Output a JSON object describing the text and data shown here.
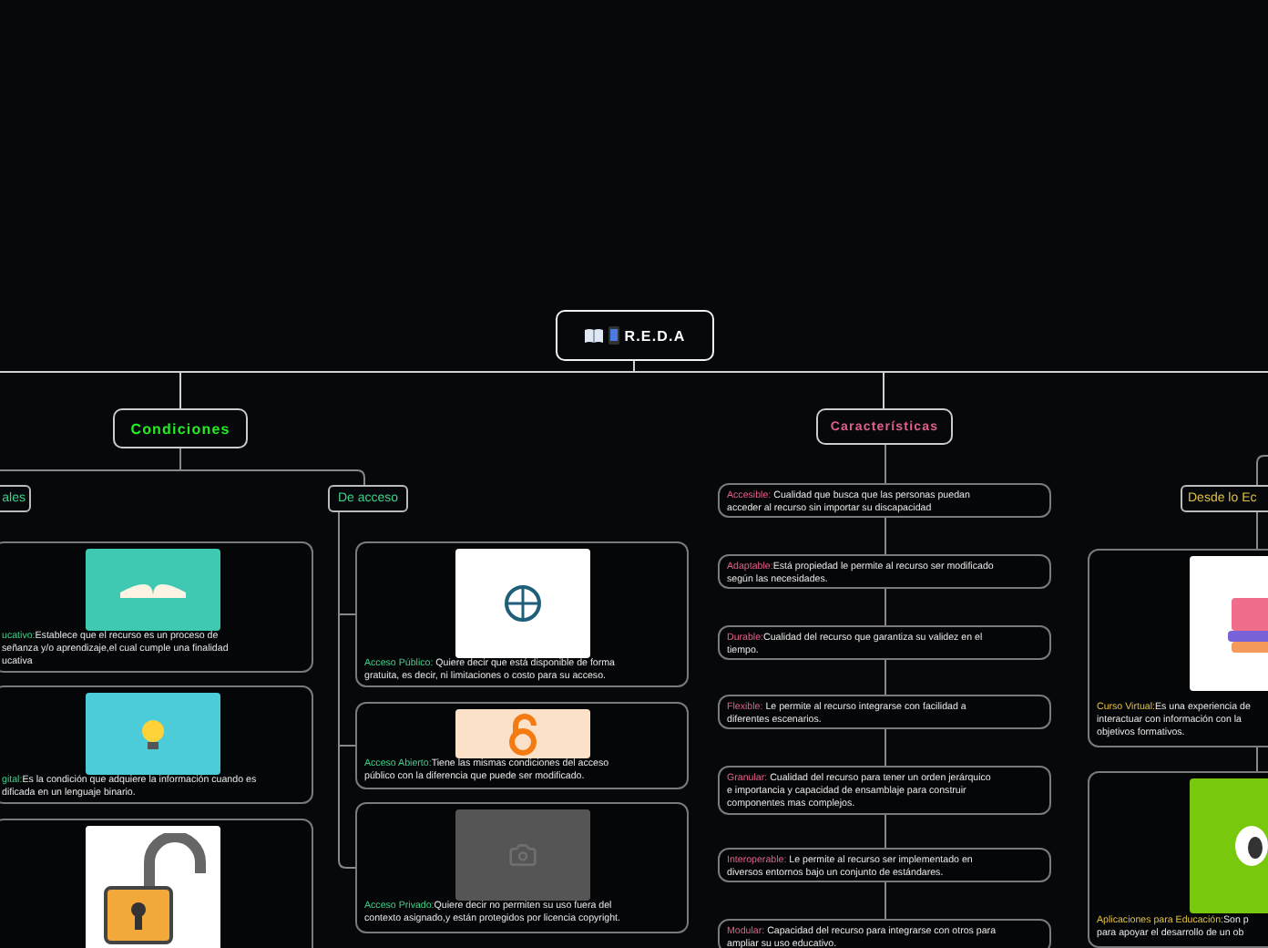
{
  "root": {
    "title": "R.E.D.A"
  },
  "condiciones": {
    "title": "Condiciones",
    "color": "#22ee22",
    "groups": [
      {
        "title": "ales",
        "color": "#3fd08a",
        "cards": [
          {
            "kind": "picture-note",
            "label": "ucativo:",
            "lines": [
              "Establece que el recurso es un proceso de",
              "señanza y/o aprendizaje,el cual cumple una finalidad",
              "ucativa"
            ]
          },
          {
            "kind": "picture-note",
            "label": "gital:",
            "lines": [
              "Es la condición que adquiere la información cuando es",
              "dificada en un lenguaje binario."
            ]
          },
          {
            "kind": "picture"
          }
        ]
      },
      {
        "title": "De acceso",
        "color": "#3fd08a",
        "cards": [
          {
            "kind": "picture-note",
            "label": "Acceso Público:",
            "lines": [
              " Quiere decir que está disponible de forma",
              "gratuita, es decir, ni limitaciones o costo para su acceso."
            ]
          },
          {
            "kind": "picture-note",
            "label": "Acceso Abierto:",
            "lines": [
              "Tiene las mismas condiciones del acceso",
              "público con la diferencia que puede ser modificado."
            ]
          },
          {
            "kind": "picture-note",
            "label": "Acceso Privado:",
            "lines": [
              "Quiere decir no permiten su uso fuera del",
              "contexto asignado,y están protegidos por licencia copyright."
            ]
          }
        ]
      }
    ]
  },
  "caracteristicas": {
    "title": "Características",
    "color": "#e0608a",
    "cards": [
      {
        "kind": "note",
        "label": "Accesible:",
        "lines": [
          " Cualidad que busca que las personas puedan",
          "acceder al recurso sin importar su discapacidad"
        ]
      },
      {
        "kind": "note",
        "label": "Adaptable:",
        "lines": [
          "Está propiedad le permite al recurso ser modificado",
          "según las necesidades."
        ]
      },
      {
        "kind": "note",
        "label": "Durable:",
        "lines": [
          "Cualidad del recurso que garantiza su validez en el",
          "tiempo."
        ]
      },
      {
        "kind": "note",
        "label": "Flexible:",
        "lines": [
          " Le permite al recurso integrarse con facilidad a",
          "diferentes escenarios."
        ]
      },
      {
        "kind": "note",
        "label": "Granular:",
        "lines": [
          " Cualidad del recurso para tener un orden jerárquico",
          "e importancia y capacidad de ensamblaje para construir",
          "componentes mas complejos."
        ]
      },
      {
        "kind": "note",
        "label": "Interoperable:",
        "lines": [
          " Le permite al recurso ser implementado en",
          "diversos entornos bajo un conjunto de estándares."
        ]
      },
      {
        "kind": "note",
        "label": "Modular:",
        "lines": [
          " Capacidad del recurso para integrarse con otros para",
          "ampliar su uso educativo."
        ]
      }
    ]
  },
  "desde": {
    "title": "Desde lo Ec",
    "color": "#e0c040",
    "cards": [
      {
        "kind": "picture-note",
        "label": "Curso Virtual:",
        "lines": [
          "Es una experiencia de",
          "interactuar con información con la",
          "objetivos formativos."
        ]
      },
      {
        "kind": "picture-note",
        "label": "Aplicaciones para Educación:",
        "lines": [
          "Son p",
          "para apoyar el desarrollo de un ob"
        ]
      }
    ]
  }
}
